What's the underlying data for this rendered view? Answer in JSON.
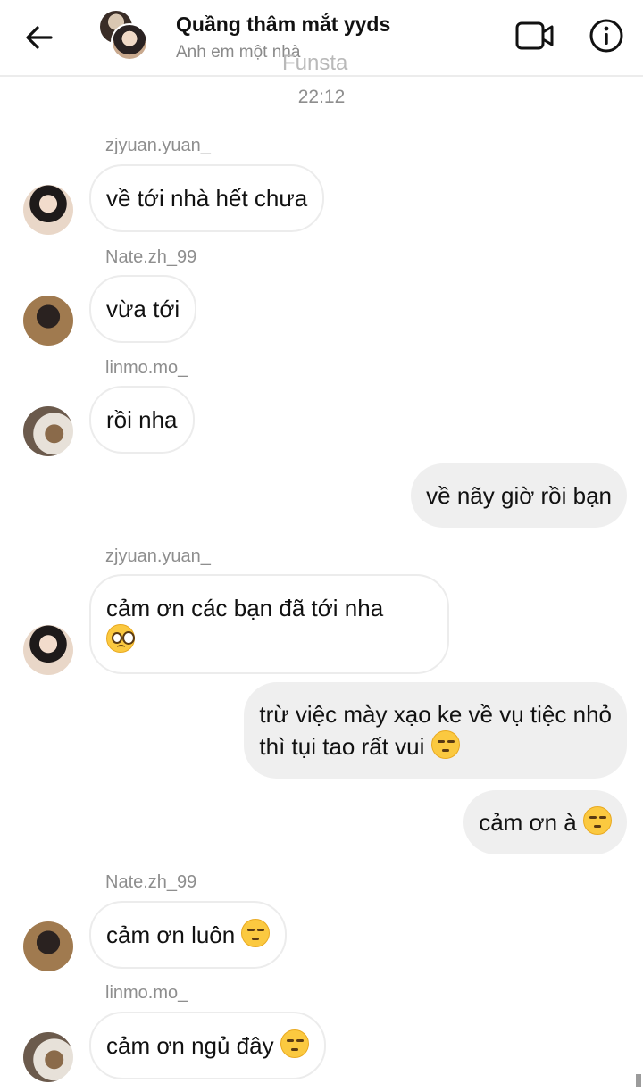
{
  "header": {
    "back_icon": "arrow-left-icon",
    "title": "Quầng thâm mắt yyds",
    "subtitle": "Anh em một nhà",
    "watermark": "Funsta",
    "video_icon": "video-call-icon",
    "info_icon": "info-icon"
  },
  "timestamp": "22:12",
  "messages": [
    {
      "sender": "zjyuan.yuan_",
      "text": "về tới nhà hết chưa"
    },
    {
      "sender": "Nate.zh_99",
      "text": "vừa tới"
    },
    {
      "sender": "linmo.mo_",
      "text": "rồi nha"
    },
    {
      "text": "về nãy giờ rồi bạn"
    },
    {
      "sender": "zjyuan.yuan_",
      "text": "cảm ơn các bạn đã tới nha",
      "emoji": "pleading-face-emoji"
    },
    {
      "text_line1": "trừ việc mày xạo ke về vụ tiệc nhỏ",
      "text_line2": "thì tụi tao rất vui",
      "emoji": "smirking-face-emoji"
    },
    {
      "text": "cảm ơn à",
      "emoji": "smirking-face-emoji"
    },
    {
      "sender": "Nate.zh_99",
      "text": "cảm ơn luôn",
      "emoji": "smirking-face-emoji"
    },
    {
      "sender": "linmo.mo_",
      "text": "cảm ơn ngủ đây",
      "emoji": "smirking-face-emoji"
    }
  ],
  "colors": {
    "incoming_bubble": "#ffffff",
    "outgoing_bubble": "#efefef",
    "meta_text": "#8e8e8e"
  }
}
